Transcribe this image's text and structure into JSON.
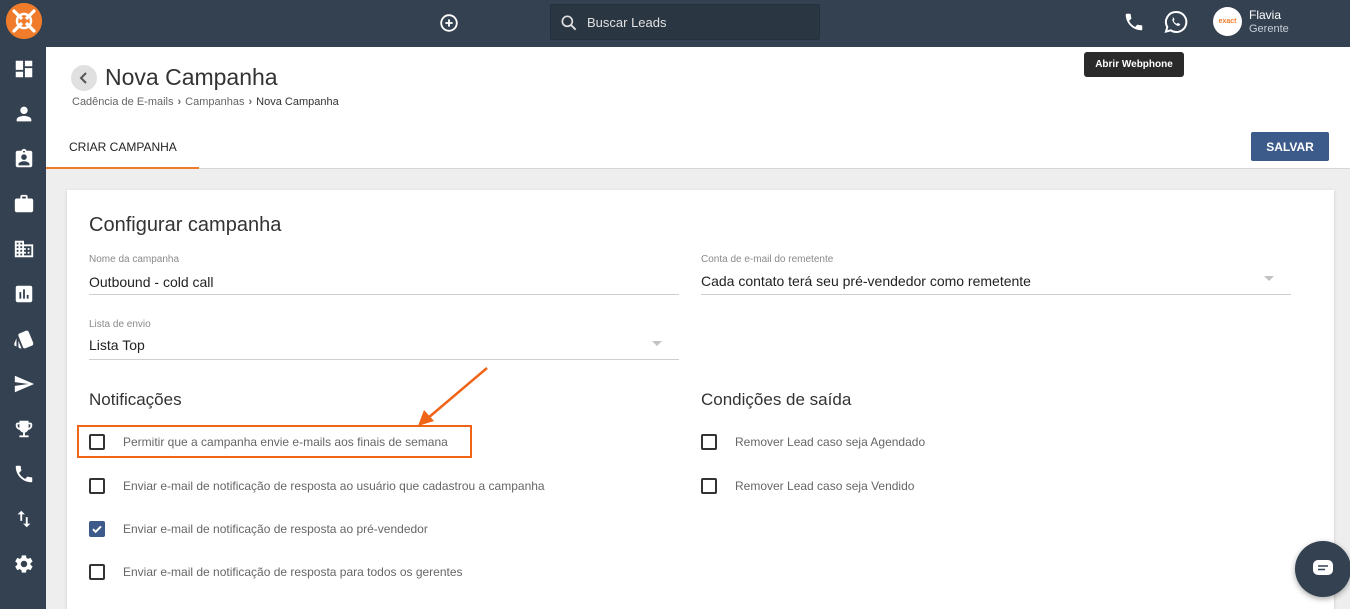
{
  "colors": {
    "nav_bg": "#344151",
    "accent_orange": "#f07c2b",
    "primary_blue": "#3c5a8a",
    "highlight": "#f06418"
  },
  "sidebar": {
    "logo_icon": "exact-logo-icon",
    "items": [
      {
        "icon": "dashboard-icon"
      },
      {
        "icon": "person-icon"
      },
      {
        "icon": "contact-card-icon"
      },
      {
        "icon": "briefcase-icon"
      },
      {
        "icon": "building-icon"
      },
      {
        "icon": "bar-chart-icon"
      },
      {
        "icon": "cards-icon"
      },
      {
        "icon": "send-icon"
      },
      {
        "icon": "trophy-icon"
      },
      {
        "icon": "phone-icon"
      },
      {
        "icon": "sync-arrows-icon"
      },
      {
        "icon": "gear-icon"
      }
    ]
  },
  "topbar": {
    "search_placeholder": "Buscar Leads",
    "user": {
      "name": "Flavia",
      "role": "Gerente",
      "avatar_text": "exact"
    },
    "tooltip": "Abrir Webphone"
  },
  "header": {
    "title": "Nova Campanha",
    "breadcrumb": [
      "Cadência de E-mails",
      "Campanhas",
      "Nova Campanha"
    ],
    "tab": "CRIAR CAMPANHA",
    "save_label": "SALVAR"
  },
  "form": {
    "title": "Configurar campanha",
    "campaign_name": {
      "label": "Nome da campanha",
      "value": "Outbound - cold call"
    },
    "sender_account": {
      "label": "Conta de e-mail do remetente",
      "value": "Cada contato terá seu pré-vendedor como remetente"
    },
    "send_list": {
      "label": "Lista de envio",
      "value": "Lista Top"
    },
    "notifications": {
      "title": "Notificações",
      "options": [
        {
          "label": "Permitir que a campanha envie e-mails aos finais de semana",
          "checked": false
        },
        {
          "label": "Enviar e-mail de notificação de resposta ao usuário que cadastrou a campanha",
          "checked": false
        },
        {
          "label": "Enviar e-mail de notificação de resposta ao pré-vendedor",
          "checked": true
        },
        {
          "label": "Enviar e-mail de notificação de resposta para todos os gerentes",
          "checked": false
        }
      ]
    },
    "exit_conditions": {
      "title": "Condições de saída",
      "options": [
        {
          "label": "Remover Lead caso seja Agendado",
          "checked": false
        },
        {
          "label": "Remover Lead caso seja Vendido",
          "checked": false
        }
      ]
    }
  }
}
